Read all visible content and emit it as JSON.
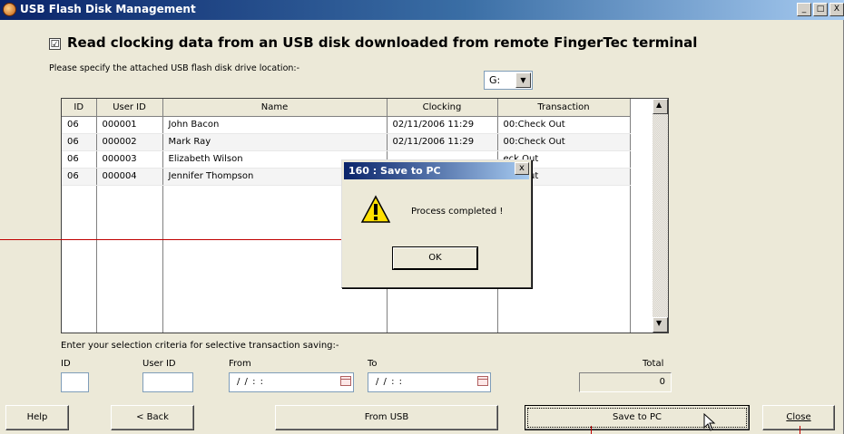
{
  "window": {
    "title": "USB Flash Disk Management",
    "controls": [
      "_",
      "□",
      "X"
    ]
  },
  "header": {
    "check_mark": "☑",
    "title": "Read clocking data from an USB disk downloaded from remote FingerTec terminal",
    "drive_label": "Please specify the attached USB flash disk drive location:-",
    "drive_value": "G:",
    "drive_arrow": "▼"
  },
  "grid": {
    "columns": [
      "ID",
      "User ID",
      "Name",
      "Clocking",
      "Transaction"
    ],
    "rows": [
      {
        "id": "06",
        "user_id": "000001",
        "name": "John Bacon",
        "clocking": "02/11/2006 11:29",
        "transaction": "00:Check Out"
      },
      {
        "id": "06",
        "user_id": "000002",
        "name": "Mark Ray",
        "clocking": "02/11/2006 11:29",
        "transaction": "00:Check Out"
      },
      {
        "id": "06",
        "user_id": "000003",
        "name": "Elizabeth Wilson",
        "clocking": "",
        "transaction": "eck Out"
      },
      {
        "id": "06",
        "user_id": "000004",
        "name": "Jennifer Thompson",
        "clocking": "",
        "transaction": "eck Out"
      }
    ],
    "scroll_up": "▲",
    "scroll_down": "▼"
  },
  "criteria": {
    "label": "Enter your selection criteria for selective transaction saving:-",
    "id_label": "ID",
    "user_id_label": "User ID",
    "from_label": "From",
    "to_label": "To",
    "total_label": "Total",
    "from_value": "/ /   : :",
    "to_value": "/ /   : :",
    "total_value": "0"
  },
  "buttons": {
    "help": "Help",
    "back": "< Back",
    "from_usb": "From USB",
    "save_to_pc": "Save to PC",
    "close": "Close"
  },
  "dialog": {
    "title": "160 : Save to PC",
    "close": "x",
    "message": "Process completed !",
    "ok": "OK",
    "icon": "warning-icon"
  },
  "colors": {
    "titlebar": "#0a246a",
    "face": "#ece9d8",
    "annotation": "#c00000"
  }
}
